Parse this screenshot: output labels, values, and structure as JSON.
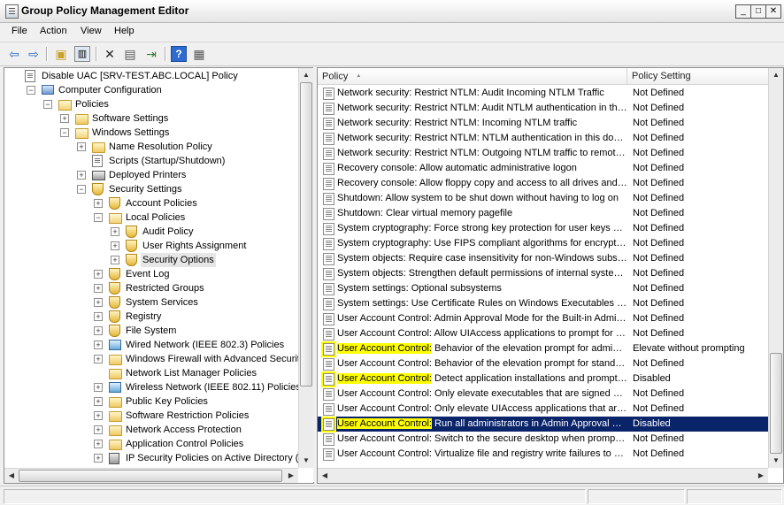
{
  "window": {
    "title": "Group Policy Management Editor",
    "minimize": "_",
    "maximize": "□",
    "close": "✕"
  },
  "menu": [
    "File",
    "Action",
    "View",
    "Help"
  ],
  "toolbar": {
    "icons": [
      "back-arrow-icon",
      "forward-arrow-icon",
      "up-folder-icon",
      "show-hide-tree-icon",
      "delete-icon",
      "properties-icon",
      "export-list-icon",
      "help-icon",
      "show-hide-action-pane-icon"
    ]
  },
  "tree": {
    "items": [
      {
        "label": "Disable UAC [SRV-TEST.ABC.LOCAL] Policy",
        "indent": 0,
        "expander": "",
        "icon": "doc"
      },
      {
        "label": "Computer Configuration",
        "indent": 1,
        "expander": "−",
        "icon": "computer"
      },
      {
        "label": "Policies",
        "indent": 2,
        "expander": "−",
        "icon": "folder-open"
      },
      {
        "label": "Software Settings",
        "indent": 3,
        "expander": "+",
        "icon": "folder"
      },
      {
        "label": "Windows Settings",
        "indent": 3,
        "expander": "−",
        "icon": "folder-open"
      },
      {
        "label": "Name Resolution Policy",
        "indent": 4,
        "expander": "+",
        "icon": "folder"
      },
      {
        "label": "Scripts (Startup/Shutdown)",
        "indent": 4,
        "expander": "",
        "icon": "doc"
      },
      {
        "label": "Deployed Printers",
        "indent": 4,
        "expander": "+",
        "icon": "printer"
      },
      {
        "label": "Security Settings",
        "indent": 4,
        "expander": "−",
        "icon": "shield"
      },
      {
        "label": "Account Policies",
        "indent": 5,
        "expander": "+",
        "icon": "shield"
      },
      {
        "label": "Local Policies",
        "indent": 5,
        "expander": "−",
        "icon": "folder-open"
      },
      {
        "label": "Audit Policy",
        "indent": 6,
        "expander": "+",
        "icon": "shield"
      },
      {
        "label": "User Rights Assignment",
        "indent": 6,
        "expander": "+",
        "icon": "shield"
      },
      {
        "label": "Security Options",
        "indent": 6,
        "expander": "+",
        "icon": "shield",
        "selected": true
      },
      {
        "label": "Event Log",
        "indent": 5,
        "expander": "+",
        "icon": "shield"
      },
      {
        "label": "Restricted Groups",
        "indent": 5,
        "expander": "+",
        "icon": "shield"
      },
      {
        "label": "System Services",
        "indent": 5,
        "expander": "+",
        "icon": "shield"
      },
      {
        "label": "Registry",
        "indent": 5,
        "expander": "+",
        "icon": "shield"
      },
      {
        "label": "File System",
        "indent": 5,
        "expander": "+",
        "icon": "shield"
      },
      {
        "label": "Wired Network (IEEE 802.3) Policies",
        "indent": 5,
        "expander": "+",
        "icon": "net"
      },
      {
        "label": "Windows Firewall with Advanced Security",
        "indent": 5,
        "expander": "+",
        "icon": "folder"
      },
      {
        "label": "Network List Manager Policies",
        "indent": 5,
        "expander": "",
        "icon": "folder"
      },
      {
        "label": "Wireless Network (IEEE 802.11) Policies",
        "indent": 5,
        "expander": "+",
        "icon": "net"
      },
      {
        "label": "Public Key Policies",
        "indent": 5,
        "expander": "+",
        "icon": "folder"
      },
      {
        "label": "Software Restriction Policies",
        "indent": 5,
        "expander": "+",
        "icon": "folder"
      },
      {
        "label": "Network Access Protection",
        "indent": 5,
        "expander": "+",
        "icon": "folder"
      },
      {
        "label": "Application Control Policies",
        "indent": 5,
        "expander": "+",
        "icon": "folder"
      },
      {
        "label": "IP Security Policies on Active Directory (ABC",
        "indent": 5,
        "expander": "+",
        "icon": "lock"
      }
    ]
  },
  "list": {
    "columns": {
      "policy": "Policy",
      "setting": "Policy Setting",
      "sort_indicator": "▲"
    },
    "rows": [
      {
        "prefix": "",
        "name": "Network security: Restrict NTLM: Audit Incoming NTLM Traffic",
        "setting": "Not Defined"
      },
      {
        "prefix": "",
        "name": "Network security: Restrict NTLM: Audit NTLM authentication in this domain",
        "setting": "Not Defined"
      },
      {
        "prefix": "",
        "name": "Network security: Restrict NTLM: Incoming NTLM traffic",
        "setting": "Not Defined"
      },
      {
        "prefix": "",
        "name": "Network security: Restrict NTLM: NTLM authentication in this domain",
        "setting": "Not Defined"
      },
      {
        "prefix": "",
        "name": "Network security: Restrict NTLM: Outgoing NTLM traffic to remote servers",
        "setting": "Not Defined"
      },
      {
        "prefix": "",
        "name": "Recovery console: Allow automatic administrative logon",
        "setting": "Not Defined"
      },
      {
        "prefix": "",
        "name": "Recovery console: Allow floppy copy and access to all drives and all folders",
        "setting": "Not Defined"
      },
      {
        "prefix": "",
        "name": "Shutdown: Allow system to be shut down without having to log on",
        "setting": "Not Defined"
      },
      {
        "prefix": "",
        "name": "Shutdown: Clear virtual memory pagefile",
        "setting": "Not Defined"
      },
      {
        "prefix": "",
        "name": "System cryptography: Force strong key protection for user keys stored on the computer",
        "setting": "Not Defined"
      },
      {
        "prefix": "",
        "name": "System cryptography: Use FIPS compliant algorithms for encryption, hashing, and signing",
        "setting": "Not Defined"
      },
      {
        "prefix": "",
        "name": "System objects: Require case insensitivity for non-Windows subsystems",
        "setting": "Not Defined"
      },
      {
        "prefix": "",
        "name": "System objects: Strengthen default permissions of internal system objects",
        "setting": "Not Defined"
      },
      {
        "prefix": "",
        "name": "System settings: Optional subsystems",
        "setting": "Not Defined"
      },
      {
        "prefix": "",
        "name": "System settings: Use Certificate Rules on Windows Executables for Software Restriction Policies",
        "setting": "Not Defined"
      },
      {
        "prefix": "",
        "name": "User Account Control: Admin Approval Mode for the Built-in Administrator account",
        "setting": "Not Defined"
      },
      {
        "prefix": "",
        "name": "User Account Control: Allow UIAccess applications to prompt for elevation",
        "setting": "Not Defined"
      },
      {
        "prefix": "User Account Control:",
        "name": " Behavior of the elevation prompt for administrators",
        "setting": "Elevate without prompting",
        "highlight": true
      },
      {
        "prefix": "",
        "name": "User Account Control: Behavior of the elevation prompt for standard users",
        "setting": "Not Defined"
      },
      {
        "prefix": "User Account Control:",
        "name": " Detect application installations and prompt for elevation",
        "setting": "Disabled",
        "highlight": true
      },
      {
        "prefix": "",
        "name": "User Account Control: Only elevate executables that are signed and validated",
        "setting": "Not Defined"
      },
      {
        "prefix": "",
        "name": "User Account Control: Only elevate UIAccess applications that are installed in secure locations",
        "setting": "Not Defined"
      },
      {
        "prefix": "User Account Control:",
        "name": " Run all administrators in Admin Approval Mode",
        "setting": "Disabled",
        "highlight": true,
        "selected": true
      },
      {
        "prefix": "",
        "name": "User Account Control: Switch to the secure desktop when prompting for elevation",
        "setting": "Not Defined"
      },
      {
        "prefix": "",
        "name": "User Account Control: Virtualize file and registry write failures to per-user locations",
        "setting": "Not Defined"
      }
    ]
  },
  "colors": {
    "selection": "#0a246a",
    "highlight": "#ffff00"
  }
}
